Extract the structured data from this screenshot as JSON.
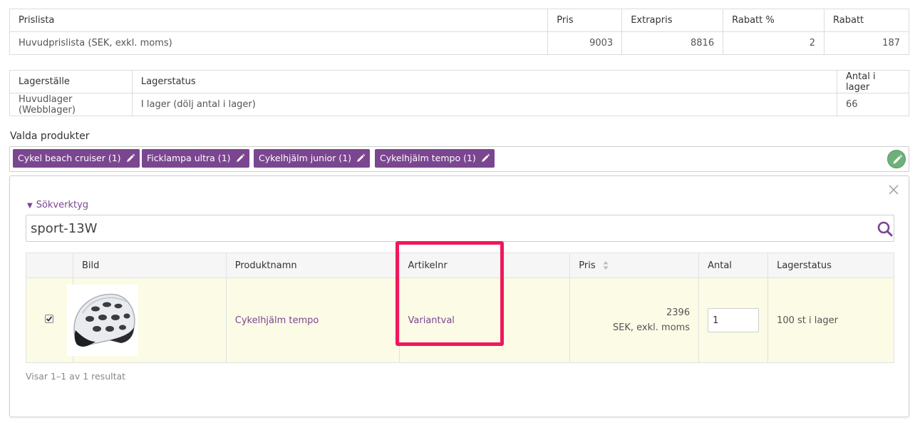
{
  "price_table": {
    "headers": [
      "Prislista",
      "Pris",
      "Extrapris",
      "Rabatt %",
      "Rabatt"
    ],
    "row": [
      "Huvudprislista (SEK, exkl. moms)",
      "9003",
      "8816",
      "2",
      "187"
    ]
  },
  "stock_table": {
    "headers": [
      "Lagerställe",
      "Lagerstatus",
      "Antal i lager"
    ],
    "row": [
      "Huvudlager (Webblager)",
      "I lager (dölj antal i lager)",
      "66"
    ]
  },
  "selected_products": {
    "label": "Valda produkter",
    "chips": [
      "Cykel beach cruiser (1)",
      "Ficklampa ultra (1)",
      "Cykelhjälm junior (1)",
      "Cykelhjälm tempo (1)"
    ]
  },
  "search": {
    "tools_label": "Sökverktyg",
    "value": "sport-13W"
  },
  "results": {
    "headers": [
      "",
      "Bild",
      "Produktnamn",
      "Artikelnr",
      "Pris",
      "Antal",
      "Lagerstatus"
    ],
    "row": {
      "checked": true,
      "product_name": "Cykelhjälm tempo",
      "article_no": "Variantval",
      "price": "2396",
      "price_note": "SEK, exkl. moms",
      "quantity": "1",
      "stock_status": "100 st i lager"
    },
    "info": "Visar 1–1 av 1 resultat"
  },
  "colors": {
    "accent": "#7b4690",
    "highlight": "#f0185c",
    "row_bg": "#fbfbe6",
    "edit_green": "#6eb07a"
  },
  "icons": [
    "pencil-icon",
    "close-icon",
    "search-icon",
    "sort-icon",
    "check-icon",
    "edit-circle-icon"
  ]
}
